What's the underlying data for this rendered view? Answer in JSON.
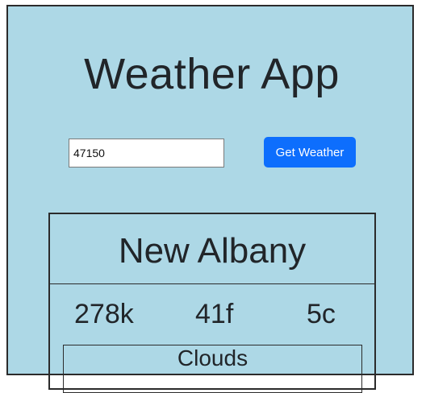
{
  "app": {
    "title": "Weather App"
  },
  "search": {
    "zip_value": "47150",
    "button_label": "Get Weather"
  },
  "weather": {
    "city": "New Albany",
    "kelvin": "278k",
    "fahrenheit": "41f",
    "celsius": "5c",
    "conditions": "Clouds"
  },
  "colors": {
    "background": "#add8e6",
    "button": "#0d6efd",
    "text": "#212529"
  }
}
